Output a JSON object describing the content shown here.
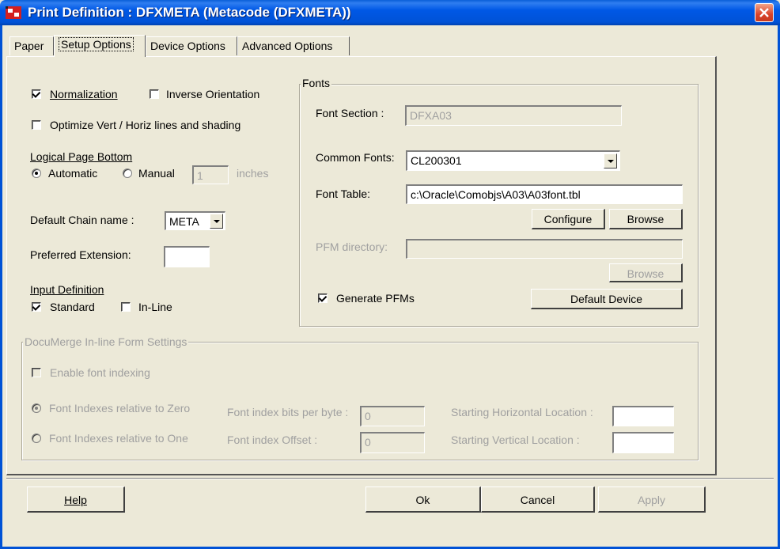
{
  "window": {
    "title": "Print Definition : DFXMETA (Metacode (DFXMETA))",
    "icon": "printer-app-icon",
    "colors": {
      "title_bar": "#0052d6",
      "close_button": "#d9432a",
      "face": "#ece9d8"
    }
  },
  "tabs": [
    {
      "label": "Paper",
      "active": false
    },
    {
      "label": "Setup Options",
      "active": true
    },
    {
      "label": "Device Options",
      "active": false
    },
    {
      "label": "Advanced Options",
      "active": false
    }
  ],
  "setup": {
    "normalization": {
      "label": "Normalization",
      "checked": true
    },
    "inverse_orientation": {
      "label": "Inverse Orientation",
      "checked": false
    },
    "optimize_lines": {
      "label": "Optimize Vert / Horiz lines and shading",
      "checked": false
    },
    "logical_page_bottom": {
      "heading": "Logical Page Bottom",
      "automatic_label": "Automatic",
      "manual_label": "Manual",
      "selected": "Automatic",
      "manual_value": "1",
      "unit": "inches"
    },
    "default_chain": {
      "label": "Default Chain name :",
      "value": "META"
    },
    "preferred_extension": {
      "label": "Preferred Extension:",
      "value": ""
    },
    "input_definition": {
      "heading": "Input Definition",
      "standard": {
        "label": "Standard",
        "checked": true
      },
      "inline": {
        "label": "In-Line",
        "checked": false
      }
    }
  },
  "fonts": {
    "legend": "Fonts",
    "font_section": {
      "label": "Font Section :",
      "value": "DFXA03"
    },
    "common_fonts": {
      "label": "Common Fonts:",
      "value": "CL200301"
    },
    "font_table": {
      "label": "Font Table:",
      "value": "c:\\Oracle\\Comobjs\\A03\\A03font.tbl"
    },
    "configure_label": "Configure",
    "browse_label": "Browse",
    "pfm_directory": {
      "label": "PFM directory:",
      "value": ""
    },
    "pfm_browse_label": "Browse",
    "generate_pfms": {
      "label": "Generate PFMs",
      "checked": true
    },
    "default_device_label": "Default Device"
  },
  "documerge": {
    "legend": "DocuMerge In-line Form Settings",
    "enable_font_indexing": {
      "label": "Enable font indexing",
      "checked": false
    },
    "relative_zero_label": "Font Indexes relative to Zero",
    "relative_one_label": "Font Indexes relative to One",
    "selected": "Zero",
    "bits_per_byte": {
      "label": "Font index bits per byte :",
      "value": "0"
    },
    "index_offset": {
      "label": "Font index Offset :",
      "value": "0"
    },
    "start_horizontal": {
      "label": "Starting Horizontal Location :",
      "value": ""
    },
    "start_vertical": {
      "label": "Starting Vertical Location :",
      "value": ""
    }
  },
  "buttons": {
    "help": "Help",
    "ok": "Ok",
    "cancel": "Cancel",
    "apply": "Apply"
  }
}
